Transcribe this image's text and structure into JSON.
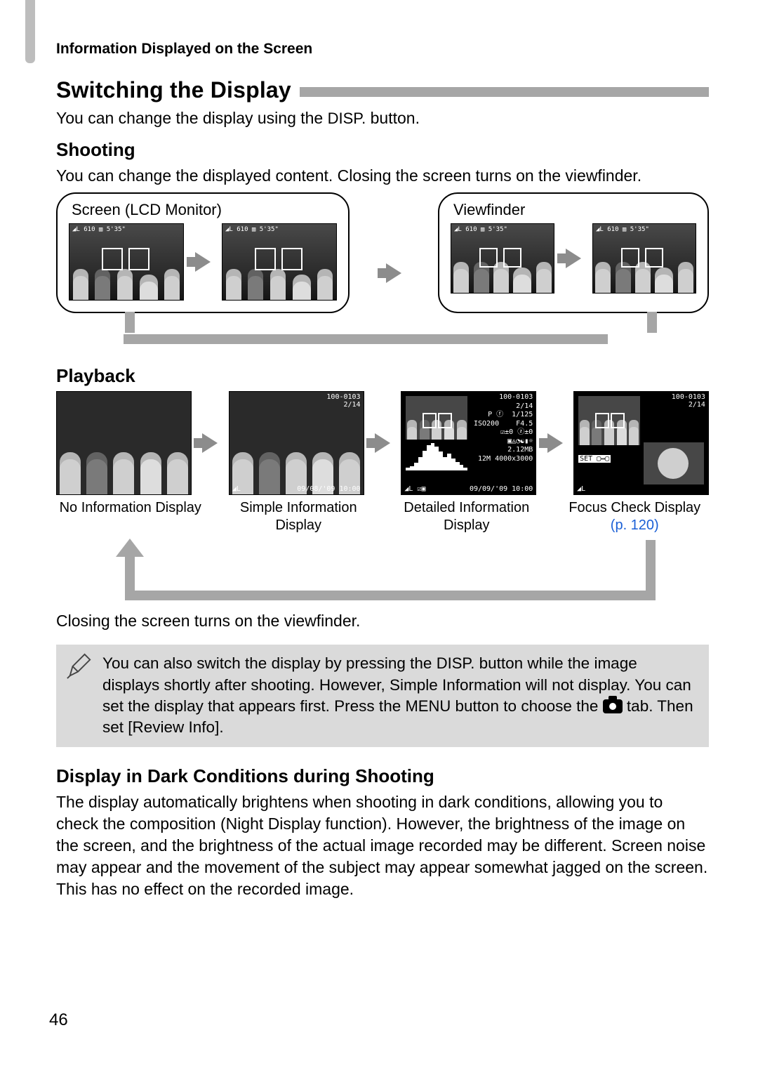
{
  "header": "Information Displayed on the Screen",
  "section_title": "Switching the Display",
  "intro_before": "You can change the display using the ",
  "disp_label": "DISP.",
  "intro_after": " button.",
  "shooting": {
    "heading": "Shooting",
    "text": "You can change the displayed content. Closing the screen turns on the viewfinder.",
    "box_lcd": "Screen (LCD Monitor)",
    "box_vf": "Viewfinder",
    "overlay_left": "◢L 610 ▥ 5'35\""
  },
  "playback": {
    "heading": "Playback",
    "captions": [
      "No Information Display",
      "Simple Information Display",
      "Detailed Information Display",
      "Focus Check Display"
    ],
    "page_ref": "(p. 120)",
    "simple_top_right": "100-0103\n2/14",
    "simple_bottom_left": "◢L",
    "simple_bottom_right": "09/08/'09   10:00",
    "detailed_info": "100-0103\n2/14\nP ⓕ  1/125\nISO200    F4.5\n☑±0 ⓩ±0\n▣◬◔☯▮☼\n       2.12MB\n12M 4000x3000",
    "detailed_bottom_left": "◢L ☑▣",
    "detailed_bottom_right": "09/09/'09  10:00",
    "focus_top_right": "100-0103\n2/14",
    "focus_set": "SET ▢↔▢",
    "focus_bottom_left": "◢L",
    "closing_text": "Closing the screen turns on the viewfinder."
  },
  "note": {
    "text_before": "You can also switch the display by pressing the ",
    "text_mid1": " button while the image displays shortly after shooting. However, Simple Information will not display. You can set the display that appears first. Press the ",
    "menu_label": "MENU",
    "text_mid2": " button to choose the ",
    "text_after": " tab. Then set [Review Info]."
  },
  "dark": {
    "heading": "Display in Dark Conditions during Shooting",
    "text": "The display automatically brightens when shooting in dark conditions, allowing you to check the composition (Night Display function). However, the brightness of the image on the screen, and the brightness of the actual image recorded may be different. Screen noise may appear and the movement of the subject may appear somewhat jagged on the screen. This has no effect on the recorded image."
  },
  "page_number": "46"
}
